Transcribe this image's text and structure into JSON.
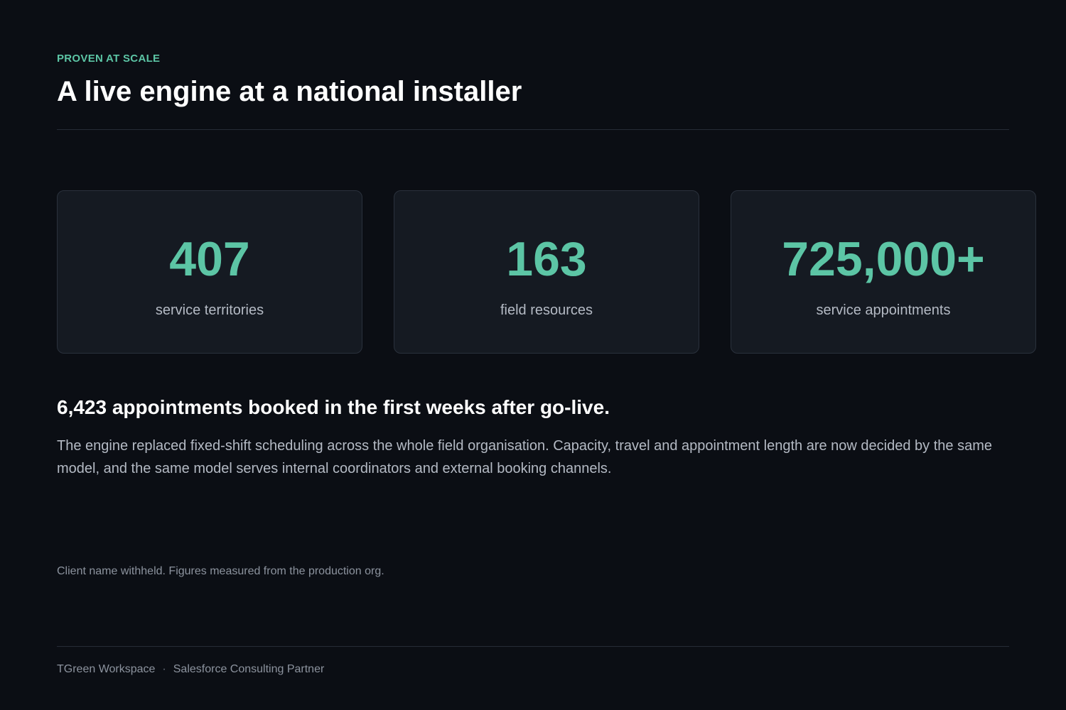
{
  "header": {
    "eyebrow": "PROVEN AT SCALE",
    "title": "A live engine at a national installer"
  },
  "stats": [
    {
      "value": "407",
      "label": "service territories"
    },
    {
      "value": "163",
      "label": "field resources"
    },
    {
      "value": "725,000+",
      "label": "service appointments"
    }
  ],
  "summary": {
    "headline": "6,423 appointments booked in the first weeks after go-live.",
    "body": "The engine replaced fixed-shift scheduling across the whole field organisation. Capacity, travel and appointment length are now decided by the same model, and the same model serves internal coordinators and external booking channels."
  },
  "footnote": "Client name withheld. Figures measured from the production org.",
  "footer": {
    "company": "TGreen Workspace",
    "separator": "·",
    "partner": "Salesforce Consulting Partner"
  },
  "colors": {
    "background": "#0b0e14",
    "accent": "#5cc5a5",
    "card": "#151a22"
  }
}
